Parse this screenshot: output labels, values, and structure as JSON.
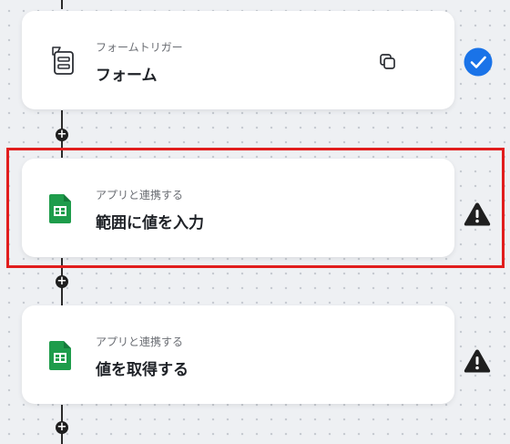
{
  "steps": [
    {
      "subtitle": "フォームトリガー",
      "title": "フォーム",
      "icon": "form-trigger-icon",
      "status": "completed"
    },
    {
      "subtitle": "アプリと連携する",
      "title": "範囲に値を入力",
      "icon": "google-sheets-icon",
      "status": "warning"
    },
    {
      "subtitle": "アプリと連携する",
      "title": "値を取得する",
      "icon": "google-sheets-icon",
      "status": "warning"
    }
  ],
  "add_step_symbol": "+",
  "colors": {
    "check_blue": "#1a73e8",
    "sheets_green": "#1e9c4b",
    "warning": "#1f1f1f",
    "highlight_red": "#e11d1d"
  }
}
